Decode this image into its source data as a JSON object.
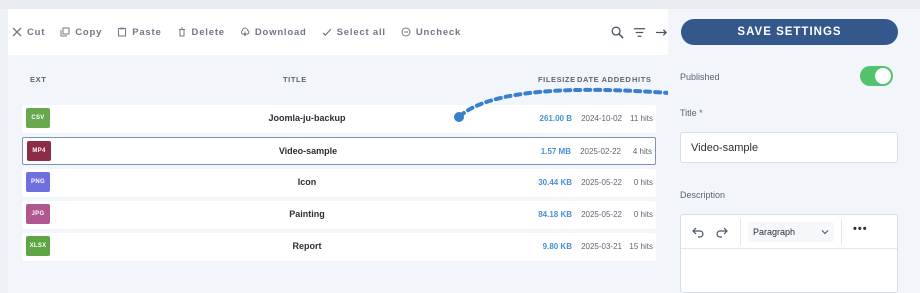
{
  "toolbar": {
    "cut": "Cut",
    "copy": "Copy",
    "paste": "Paste",
    "delete": "Delete",
    "download": "Download",
    "select_all": "Select all",
    "uncheck": "Uncheck"
  },
  "table": {
    "headers": {
      "ext": "EXT",
      "title": "TITLE",
      "filesize": "FILESIZE",
      "date_added": "DATE ADDED",
      "hits": "HITS"
    },
    "rows": [
      {
        "ext": "CSV",
        "title": "Joomla-ju-backup",
        "filesize": "261.00 B",
        "date": "2024-10-02",
        "hits": "11 hits",
        "color": "#6aa84f"
      },
      {
        "ext": "MP4",
        "title": "Video-sample",
        "filesize": "1.57 MB",
        "date": "2025-02-22",
        "hits": "4 hits",
        "color": "#8e2c48"
      },
      {
        "ext": "PNG",
        "title": "Icon",
        "filesize": "30.44 KB",
        "date": "2025-05-22",
        "hits": "0 hits",
        "color": "#6f6fe0"
      },
      {
        "ext": "JPG",
        "title": "Painting",
        "filesize": "84.18 KB",
        "date": "2025-05-22",
        "hits": "0 hits",
        "color": "#b0578f"
      },
      {
        "ext": "XLSX",
        "title": "Report",
        "filesize": "9.80 KB",
        "date": "2025-03-21",
        "hits": "15 hits",
        "color": "#5fa545"
      }
    ],
    "selected_row": 1
  },
  "settings": {
    "save_label": "SAVE SETTINGS",
    "published_label": "Published",
    "published": true,
    "title_label": "Title *",
    "title_value": "Video-sample",
    "description_label": "Description",
    "format_select": "Paragraph",
    "more_label": "•••"
  },
  "colors": {
    "accent": "#34588c",
    "link": "#4a90d9",
    "toggle_on": "#52c26c",
    "arrow": "#3a7fc9"
  }
}
